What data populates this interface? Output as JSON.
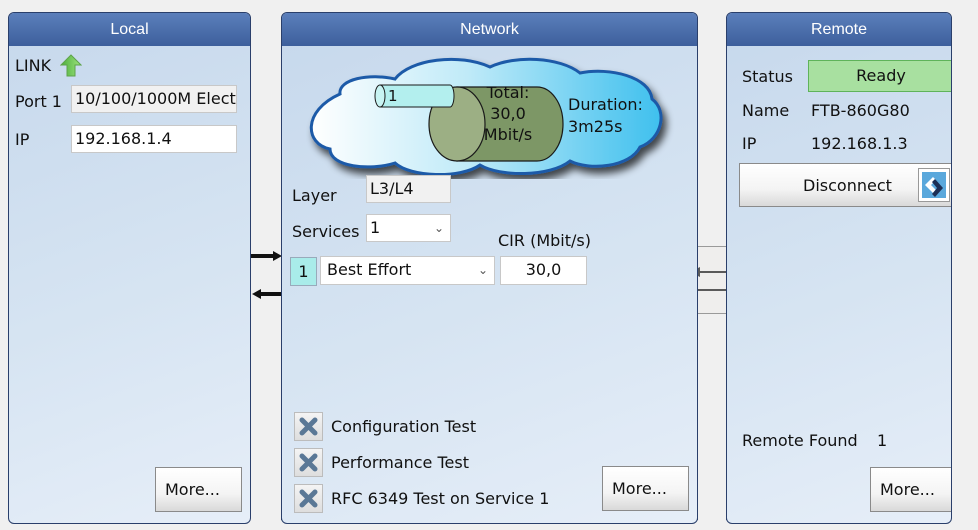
{
  "local": {
    "title": "Local",
    "link_label": "LINK",
    "link_icon": "green-up-arrow-icon",
    "port_label": "Port 1",
    "port_value": "10/100/1000M Elect",
    "ip_label": "IP",
    "ip_value": "192.168.1.4",
    "more_label": "More..."
  },
  "network": {
    "title": "Network",
    "cloud": {
      "stream_label": "1",
      "total_label": "Total:",
      "total_value": "30,0",
      "total_unit": "Mbit/s",
      "duration_label": "Duration:",
      "duration_value": "3m25s"
    },
    "layer_label": "Layer",
    "layer_value": "L3/L4",
    "services_label": "Services",
    "services_value": "1",
    "cir_header": "CIR (Mbit/s)",
    "service_rows": [
      {
        "index": "1",
        "type": "Best Effort",
        "cir": "30,0"
      }
    ],
    "tests": [
      {
        "label": "Configuration Test",
        "checked": false
      },
      {
        "label": "Performance Test",
        "checked": false
      },
      {
        "label": "RFC 6349 Test on Service 1",
        "checked": false
      }
    ],
    "more_label": "More..."
  },
  "remote": {
    "title": "Remote",
    "status_label": "Status",
    "status_value": "Ready",
    "status_color": "#a8e0a0",
    "name_label": "Name",
    "name_value": "FTB-860G80",
    "ip_label": "IP",
    "ip_value": "192.168.1.3",
    "disconnect_label": "Disconnect",
    "remote_found_label": "Remote Found",
    "remote_found_value": "1",
    "more_label": "More..."
  }
}
